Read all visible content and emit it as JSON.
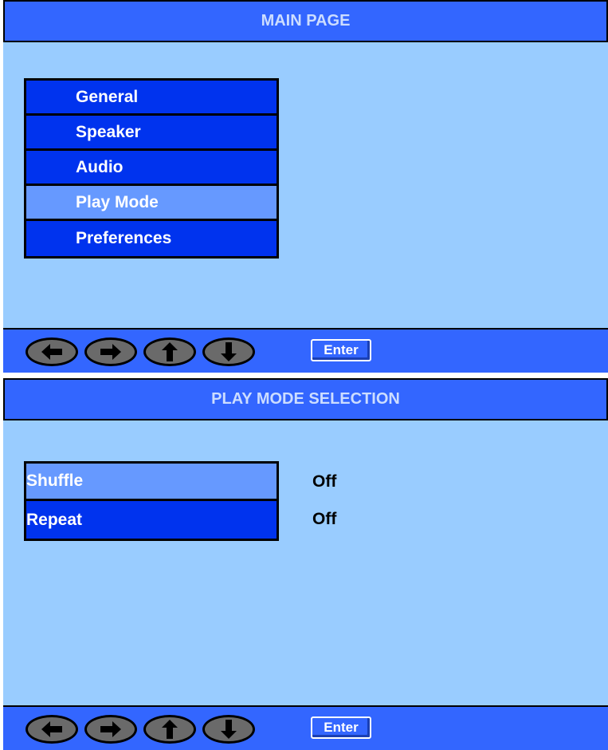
{
  "main_page": {
    "title": "MAIN PAGE",
    "menu": [
      {
        "label": "General",
        "selected": false
      },
      {
        "label": "Speaker",
        "selected": false
      },
      {
        "label": "Audio",
        "selected": false
      },
      {
        "label": "Play Mode",
        "selected": true
      },
      {
        "label": "Preferences",
        "selected": false
      }
    ],
    "nav": {
      "buttons": [
        "left-arrow-icon",
        "right-arrow-icon",
        "up-arrow-icon",
        "down-arrow-icon"
      ],
      "enter_label": "Enter"
    }
  },
  "play_mode_page": {
    "title": "PLAY MODE SELECTION",
    "options": [
      {
        "label": "Shuffle",
        "value": "Off",
        "selected": true
      },
      {
        "label": "Repeat",
        "value": "Off",
        "selected": false
      }
    ],
    "nav": {
      "buttons": [
        "left-arrow-icon",
        "right-arrow-icon",
        "up-arrow-icon",
        "down-arrow-icon"
      ],
      "enter_label": "Enter"
    }
  },
  "colors": {
    "panel_background": "#99ccff",
    "bar_background": "#3366ff",
    "menu_item": "#0033ee",
    "menu_item_selected": "#6699ff"
  }
}
